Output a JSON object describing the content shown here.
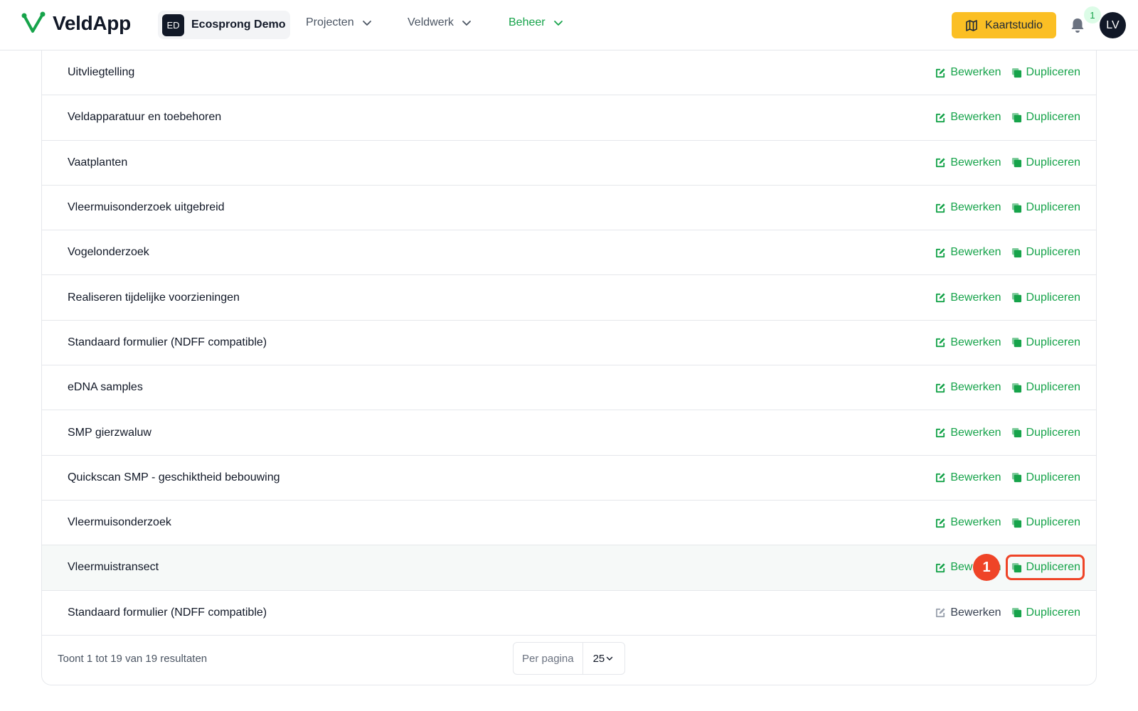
{
  "app": {
    "name": "VeldApp"
  },
  "org": {
    "initials": "ED",
    "name": "Ecosprong Demo"
  },
  "nav": [
    {
      "label": "Projecten",
      "active": false
    },
    {
      "label": "Veldwerk",
      "active": false
    },
    {
      "label": "Beheer",
      "active": true
    }
  ],
  "header": {
    "studio_label": "Kaartstudio",
    "notification_count": "1",
    "user_initials": "LV"
  },
  "actions": {
    "edit_label": "Bewerken",
    "duplicate_label": "Dupliceren"
  },
  "rows": [
    {
      "name": "Uitvliegtelling"
    },
    {
      "name": "Veldapparatuur en toebehoren"
    },
    {
      "name": "Vaatplanten"
    },
    {
      "name": "Vleermuisonderzoek uitgebreid"
    },
    {
      "name": "Vogelonderzoek"
    },
    {
      "name": "Realiseren tijdelijke voorzieningen"
    },
    {
      "name": "Standaard formulier (NDFF compatible)"
    },
    {
      "name": "eDNA samples"
    },
    {
      "name": "SMP gierzwaluw"
    },
    {
      "name": "Quickscan SMP - geschiktheid bebouwing"
    },
    {
      "name": "Vleermuisonderzoek"
    },
    {
      "name": "Vleermuistransect"
    },
    {
      "name": "Standaard formulier (NDFF compatible)"
    }
  ],
  "annotation": {
    "marker_label": "1"
  },
  "footer": {
    "results_text": "Toont 1 tot 19 van 19 resultaten",
    "per_page_label": "Per pagina",
    "per_page_value": "25"
  },
  "colors": {
    "accent": "#16a34a",
    "brand_yellow": "#fbbf24",
    "highlight": "#ef4427"
  }
}
